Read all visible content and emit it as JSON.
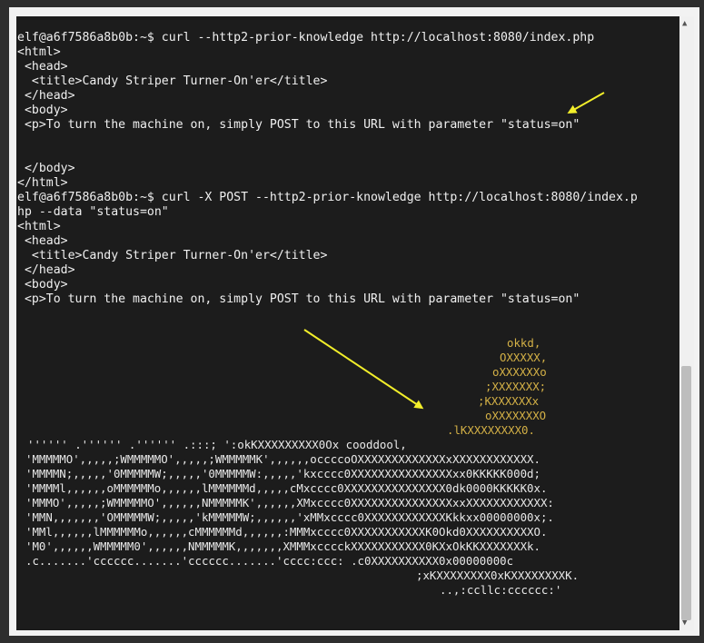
{
  "terminal": {
    "lines": [
      "elf@a6f7586a8b0b:~$ curl --http2-prior-knowledge http://localhost:8080/index.php",
      "<html>",
      " <head>",
      "  <title>Candy Striper Turner-On'er</title>",
      " </head>",
      " <body>",
      " <p>To turn the machine on, simply POST to this URL with parameter \"status=on\"",
      "",
      "",
      " </body>",
      "</html>",
      "elf@a6f7586a8b0b:~$ curl -X POST --http2-prior-knowledge http://localhost:8080/index.p",
      "hp --data \"status=on\"",
      "<html>",
      " <head>",
      "  <title>Candy Striper Turner-On'er</title>",
      " </head>",
      " <body>",
      " <p>To turn the machine on, simply POST to this URL with parameter \"status=on\""
    ],
    "ascii_art": [
      {
        "text": "okkd,",
        "color": "#d3b046"
      },
      {
        "text": "OXXXXX,",
        "color": "#d3b046"
      },
      {
        "text": "oXXXXXXo",
        "color": "#d3b046"
      },
      {
        "text": ";XXXXXXX;",
        "color": "#d3b046"
      },
      {
        "text": ";KXXXXXXx",
        "color": "#d3b046"
      },
      {
        "text": "oXXXXXXXO",
        "color": "#d3b046"
      },
      {
        "text": ".lKXXXXXXXX0.",
        "color": "#d3b046"
      },
      {
        "text": "''''''       .''''''       .''''''       .:::;   ':okKXXXXXXXXX0Ox cooddool,",
        "color": "#e8e8e8"
      },
      {
        "text": "'MMMMMO',,,,,;WMMMMMO',,,,,;WMMMMMK',,,,,,occccoOXXXXXXXXXXXXXxXXXXXXXXXXXX.",
        "color": "#e8e8e8"
      },
      {
        "text": "'MMMMN;,,,,,'0MMMMMW;,,,,,'0MMMMMW:,,,,,'kxcccc0XXXXXXXXXXXXXXXxx0KKKKK000d;",
        "color": "#e8e8e8"
      },
      {
        "text": "'MMMMl,,,,,,oMMMMMMo,,,,,,lMMMMMMd,,,,,cMxcccc0XXXXXXXXXXXXXXX0dk0000KKKKK0x.",
        "color": "#e8e8e8"
      },
      {
        "text": "'MMMO',,,,,;WMMMMMO',,,,,,NMMMMMK',,,,,,XMxcccc0XXXXXXXXXXXXXXXxxXXXXXXXXXXXX:",
        "color": "#e8e8e8"
      },
      {
        "text": "'MMN,,,,,,,'OMMMMMW;,,,,,'kMMMMMW;,,,,,,'xMMxcccc0XXXXXXXXXXXXKkkxx00000000x;.",
        "color": "#e8e8e8"
      },
      {
        "text": "'MMl,,,,,,lMMMMMMo,,,,,,cMMMMMMd,,,,,,:MMMxcccc0XXXXXXXXXXXK0Okd0XXXXXXXXXXO.",
        "color": "#e8e8e8"
      },
      {
        "text": "'M0',,,,,,WMMMMM0',,,,,,NMMMMMK,,,,,,,XMMMxcccckXXXXXXXXXXX0KXxOkKKXXXXXXXk.",
        "color": "#e8e8e8"
      },
      {
        "text": ".c.......'cccccc.......'cccccc.......'cccc:ccc: .c0XXXXXXXXXX0x00000000c",
        "color": "#e8e8e8"
      },
      {
        "text": ";xKXXXXXXXX0xKXXXXXXXXK.",
        "color": "#e8e8e8"
      },
      {
        "text": "..,:ccllc:cccccc:'",
        "color": "#e8e8e8"
      }
    ]
  },
  "colors": {
    "annotation_arrow": "#f2ee2a"
  }
}
